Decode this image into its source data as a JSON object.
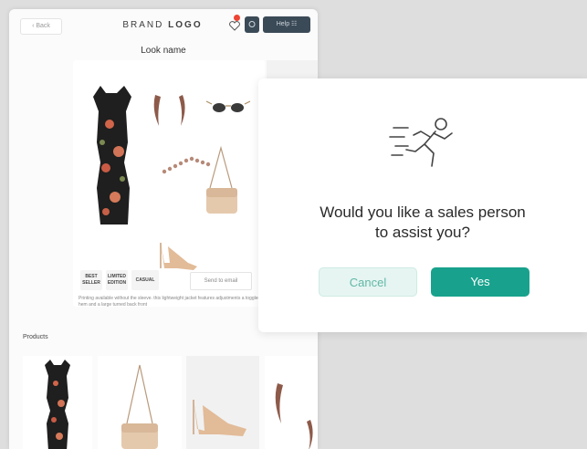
{
  "header": {
    "back_label": "‹ Back",
    "brand_light": "BRAND ",
    "brand_bold": "LOGO",
    "help_label": "Help ☷"
  },
  "look": {
    "title": "Look name",
    "badges": [
      {
        "label": "BEST SELLER"
      },
      {
        "label": "LIMITED EDITION"
      },
      {
        "label": "CASUAL"
      }
    ],
    "send_email_label": "Send to email",
    "description": "Printing available without the sleeve. this lightweight jacket features adjustments a toggled hem and a large turned back front"
  },
  "products": {
    "label": "Products"
  },
  "dialog": {
    "question_line1": "Would you like a sales person",
    "question_line2": "to assist you?",
    "cancel_label": "Cancel",
    "yes_label": "Yes",
    "icon": "running-person-icon",
    "accent_color": "#18a28d"
  }
}
